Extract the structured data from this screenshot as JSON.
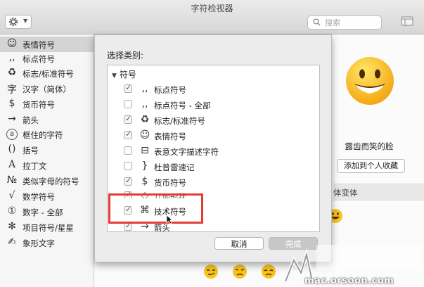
{
  "window": {
    "title": "字符检视器"
  },
  "toolbar": {
    "search_placeholder": "搜索"
  },
  "sidebar": {
    "items": [
      {
        "icon": "☺",
        "label": "表情符号",
        "selected": true
      },
      {
        "icon": ",,",
        "label": "标点符号"
      },
      {
        "icon": "♻",
        "label": "标志/标准符号"
      },
      {
        "icon": "字",
        "label": "汉字（简体）"
      },
      {
        "icon": "$",
        "label": "货币符号"
      },
      {
        "icon": "→",
        "label": "箭头"
      },
      {
        "icon": "a",
        "label": "框住的字符"
      },
      {
        "icon": "()",
        "label": "括号"
      },
      {
        "icon": "A",
        "label": "拉丁文"
      },
      {
        "icon": "№",
        "label": "类似字母的符号"
      },
      {
        "icon": "√",
        "label": "数学符号"
      },
      {
        "icon": "①",
        "label": "数字 - 全部"
      },
      {
        "icon": "✻",
        "label": "项目符号/星星"
      },
      {
        "icon": "✍",
        "label": "象形文字"
      }
    ]
  },
  "detail": {
    "name": "露齿而笑的脸",
    "add_favorite": "添加到个人收藏",
    "variants_header": "体变体"
  },
  "dialog": {
    "label": "选择类别:",
    "group": "符号",
    "rows": [
      {
        "icon": ",,",
        "label": "标点符号",
        "checked": true
      },
      {
        "icon": ",,",
        "label": "标点符号 - 全部",
        "checked": false
      },
      {
        "icon": "♻",
        "label": "标志/标准符号",
        "checked": true
      },
      {
        "icon": "☺",
        "label": "表情符号",
        "checked": true
      },
      {
        "icon": "⊟",
        "label": "表意文字描述字符",
        "checked": false
      },
      {
        "icon": "}",
        "label": "杜普雷速记",
        "checked": false
      },
      {
        "icon": "$",
        "label": "货币符号",
        "checked": true
      },
      {
        "icon": "◇",
        "label": "几何形状",
        "checked": true
      },
      {
        "icon": "⌘",
        "label": "技术符号",
        "checked": true
      },
      {
        "icon": "→",
        "label": "箭头",
        "checked": true
      }
    ],
    "cancel": "取消",
    "done": "完成"
  },
  "watermark": {
    "text": "mac.orsoon.com"
  }
}
